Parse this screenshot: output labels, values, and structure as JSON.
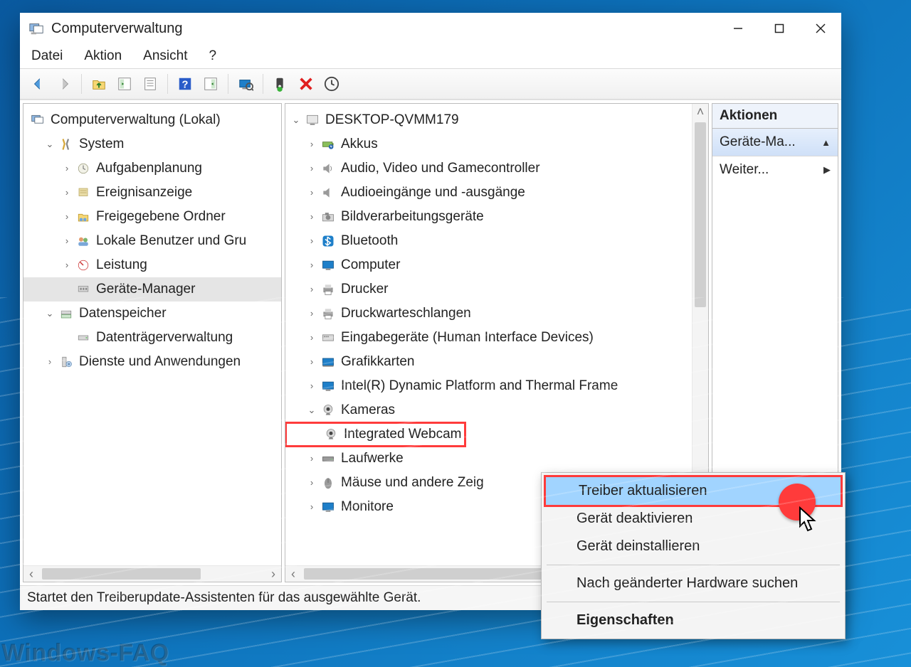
{
  "window": {
    "title": "Computerverwaltung",
    "menus": [
      "Datei",
      "Aktion",
      "Ansicht",
      "?"
    ]
  },
  "left_tree": {
    "root": "Computerverwaltung (Lokal)",
    "system": "System",
    "system_children": [
      "Aufgabenplanung",
      "Ereignisanzeige",
      "Freigegebene Ordner",
      "Lokale Benutzer und Gru",
      "Leistung",
      "Geräte-Manager"
    ],
    "storage": "Datenspeicher",
    "storage_children": [
      "Datenträgerverwaltung"
    ],
    "services": "Dienste und Anwendungen"
  },
  "device_tree": {
    "root": "DESKTOP-QVMM179",
    "items": [
      "Akkus",
      "Audio, Video und Gamecontroller",
      "Audioeingänge und -ausgänge",
      "Bildverarbeitungsgeräte",
      "Bluetooth",
      "Computer",
      "Drucker",
      "Druckwarteschlangen",
      "Eingabegeräte (Human Interface Devices)",
      "Grafikkarten",
      "Intel(R) Dynamic Platform and Thermal Frame",
      "Kameras",
      "Laufwerke",
      "Mäuse und andere Zeig",
      "Monitore"
    ],
    "camera_child": "Integrated Webcam"
  },
  "actions": {
    "header": "Aktionen",
    "item1": "Geräte-Ma...",
    "item2": "Weiter..."
  },
  "context_menu": {
    "update_driver": "Treiber aktualisieren",
    "disable": "Gerät deaktivieren",
    "uninstall": "Gerät deinstallieren",
    "scan": "Nach geänderter Hardware suchen",
    "properties": "Eigenschaften"
  },
  "statusbar": "Startet den Treiberupdate-Assistenten für das ausgewählte Gerät.",
  "watermark": "Windows-FAQ"
}
